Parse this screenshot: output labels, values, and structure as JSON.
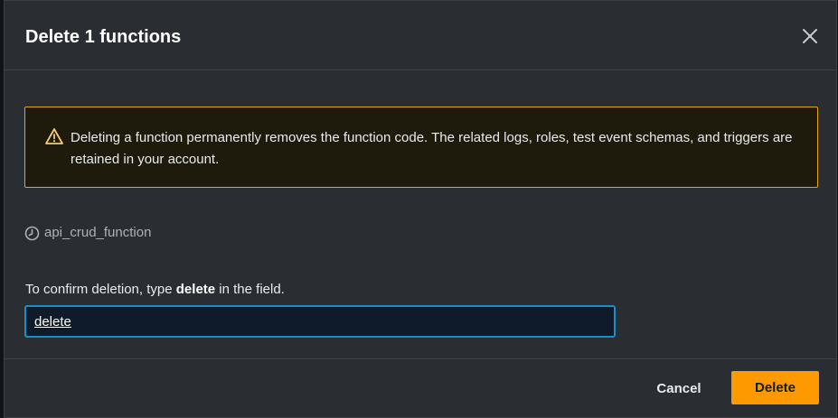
{
  "dialog": {
    "title": "Delete 1 functions",
    "close_icon": "close-icon"
  },
  "alert": {
    "icon": "warning-icon",
    "message": "Deleting a function permanently removes the function code. The related logs, roles, test event schemas, and triggers are retained in your account.",
    "accent_color": "#e8a21a"
  },
  "function": {
    "icon": "clock-icon",
    "name": "api_crud_function"
  },
  "confirm": {
    "label_prefix": "To confirm deletion, type ",
    "label_keyword": "delete",
    "label_suffix": " in the field.",
    "input_value": "delete"
  },
  "footer": {
    "cancel_label": "Cancel",
    "delete_label": "Delete",
    "delete_color": "#ff9900"
  }
}
